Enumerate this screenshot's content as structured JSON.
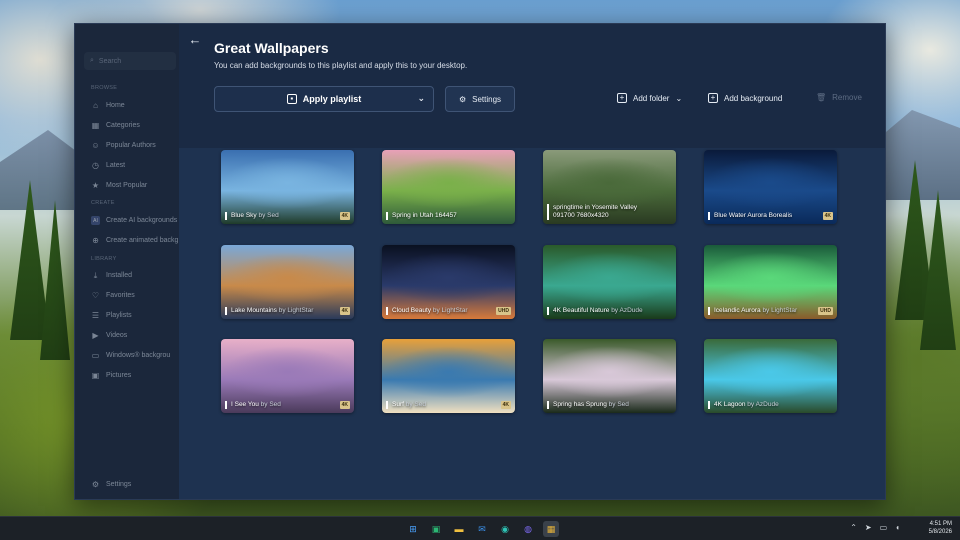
{
  "sidebar": {
    "search_placeholder": "Search",
    "browse_label": "BROWSE",
    "create_label": "Create",
    "library_label": "LIBRARY",
    "browse_items": [
      {
        "label": "Home",
        "icon": "home-icon"
      },
      {
        "label": "Categories",
        "icon": "categories-icon"
      },
      {
        "label": "Popular Authors",
        "icon": "authors-icon"
      },
      {
        "label": "Latest",
        "icon": "clock-icon"
      },
      {
        "label": "Most Popular",
        "icon": "star-icon"
      }
    ],
    "create_items": [
      {
        "label": "Create AI backgrounds",
        "icon": "ai-icon"
      },
      {
        "label": "Create animated backg",
        "icon": "plus-icon"
      }
    ],
    "library_items": [
      {
        "label": "Installed",
        "icon": "download-icon"
      },
      {
        "label": "Favorites",
        "icon": "heart-icon"
      },
      {
        "label": "Playlists",
        "icon": "playlist-icon"
      },
      {
        "label": "Videos",
        "icon": "video-icon"
      },
      {
        "label": "Windows® backgrou",
        "icon": "windows-icon"
      },
      {
        "label": "Pictures",
        "icon": "picture-icon"
      }
    ],
    "settings_label": "Settings"
  },
  "header": {
    "title": "Great Wallpapers",
    "subtitle": "You can add backgrounds to this playlist and apply this to your desktop.",
    "apply_label": "Apply playlist",
    "settings_label": "Settings",
    "add_folder_label": "Add folder",
    "add_background_label": "Add background",
    "remove_label": "Remove"
  },
  "wallpapers": [
    {
      "title": "Blue Sky",
      "author": "by Sed",
      "badge": "4K",
      "colors": [
        "#3a6fb0",
        "#79b4e0",
        "#1f3b2a"
      ]
    },
    {
      "title": "Spring in Utah 164457",
      "author": "",
      "badge": "",
      "colors": [
        "#e8a0b8",
        "#7ab04a",
        "#2e5a3a"
      ]
    },
    {
      "title": "springtime in Yosemite Valley 091700 7680x4320",
      "author": "",
      "badge": "",
      "colors": [
        "#8a9a7a",
        "#4a6a3a",
        "#2a3a22"
      ]
    },
    {
      "title": "Blue Water Aurora Borealis",
      "author": "",
      "badge": "4K",
      "colors": [
        "#0a1a3a",
        "#1a4a8a",
        "#0a2a5a"
      ]
    },
    {
      "title": "Lake Mountains",
      "author": "by LightStar",
      "badge": "4K",
      "colors": [
        "#7aa8d8",
        "#c88a4a",
        "#2a3a5a"
      ]
    },
    {
      "title": "Cloud Beauty",
      "author": "by LightStar",
      "badge": "UHD",
      "colors": [
        "#0a1020",
        "#2a3a6a",
        "#d87a3a"
      ]
    },
    {
      "title": "4K Beautiful Nature",
      "author": "by AzDude",
      "badge": "",
      "colors": [
        "#2a5a2a",
        "#3aa890",
        "#1a3a1a"
      ]
    },
    {
      "title": "Icelandic Aurora",
      "author": "by LightStar",
      "badge": "UHD",
      "colors": [
        "#1a5a3a",
        "#5ad87a",
        "#8a5a2a"
      ]
    },
    {
      "title": "I See You",
      "author": "by Sed",
      "badge": "4K",
      "colors": [
        "#e8b0c8",
        "#9a7ab8",
        "#4a3a5a"
      ]
    },
    {
      "title": "Surf",
      "author": "by Sed",
      "badge": "4K",
      "colors": [
        "#e8a03a",
        "#3a7ab0",
        "#f0e0c0"
      ]
    },
    {
      "title": "Spring has Sprung",
      "author": "by Sed",
      "badge": "",
      "colors": [
        "#3a5a2a",
        "#d8c8d8",
        "#1a2a1a"
      ]
    },
    {
      "title": "4K Lagoon",
      "author": "by AzDude",
      "badge": "",
      "colors": [
        "#3a6a3a",
        "#4ac8e8",
        "#2a4a2a"
      ]
    }
  ],
  "taskbar": {
    "apps": [
      {
        "icon": "windows-start-icon",
        "glyph": "⊞"
      },
      {
        "icon": "store-icon",
        "glyph": "▣"
      },
      {
        "icon": "folder-icon",
        "glyph": "▬"
      },
      {
        "icon": "mail-icon",
        "glyph": "✉"
      },
      {
        "icon": "edge-icon",
        "glyph": "◉"
      },
      {
        "icon": "teams-icon",
        "glyph": "◍"
      },
      {
        "icon": "wallpaper-app-icon",
        "glyph": "▦"
      }
    ],
    "time": "4:51 PM",
    "date": "5/8/2026"
  }
}
